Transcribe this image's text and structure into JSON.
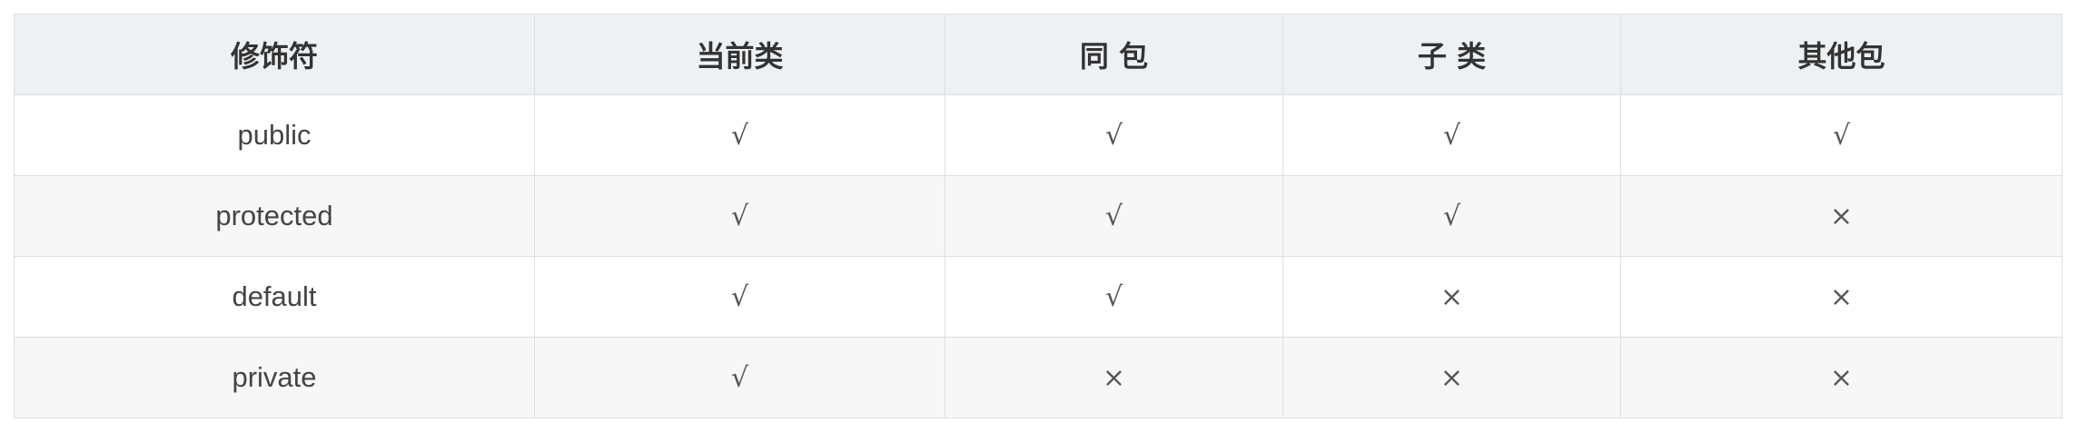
{
  "table": {
    "headers": [
      "修饰符",
      "当前类",
      "同 包",
      "子 类",
      "其他包"
    ],
    "rows": [
      [
        "public",
        "√",
        "√",
        "√",
        "√"
      ],
      [
        "protected",
        "√",
        "√",
        "√",
        "×"
      ],
      [
        "default",
        "√",
        "√",
        "×",
        "×"
      ],
      [
        "private",
        "√",
        "×",
        "×",
        "×"
      ]
    ]
  }
}
